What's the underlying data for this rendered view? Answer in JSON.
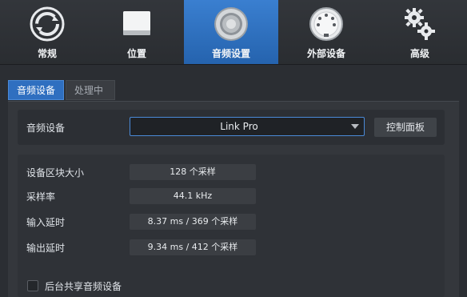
{
  "toolbar": {
    "items": [
      {
        "label": "常规",
        "icon": "sync-icon"
      },
      {
        "label": "位置",
        "icon": "drive-icon"
      },
      {
        "label": "音频设置",
        "icon": "speaker-icon"
      },
      {
        "label": "外部设备",
        "icon": "midi-connector-icon"
      },
      {
        "label": "高级",
        "icon": "gears-icon"
      }
    ],
    "active_index": 2
  },
  "subtabs": {
    "active": "音频设备",
    "inactive": "处理中"
  },
  "device": {
    "label": "音频设备",
    "selected": "Link Pro",
    "control_panel_button": "控制面板"
  },
  "stats": {
    "block_size": {
      "label": "设备区块大小",
      "value": "128 个采样"
    },
    "sample_rate": {
      "label": "采样率",
      "value": "44.1 kHz"
    },
    "input_latency": {
      "label": "输入延时",
      "value": "8.37 ms / 369 个采样"
    },
    "output_latency": {
      "label": "输出延时",
      "value": "9.34 ms / 412 个采样"
    }
  },
  "background_share": {
    "label": "后台共享音频设备",
    "checked": false
  },
  "colors": {
    "accent": "#2f6fc0",
    "background": "#2b2e33"
  }
}
